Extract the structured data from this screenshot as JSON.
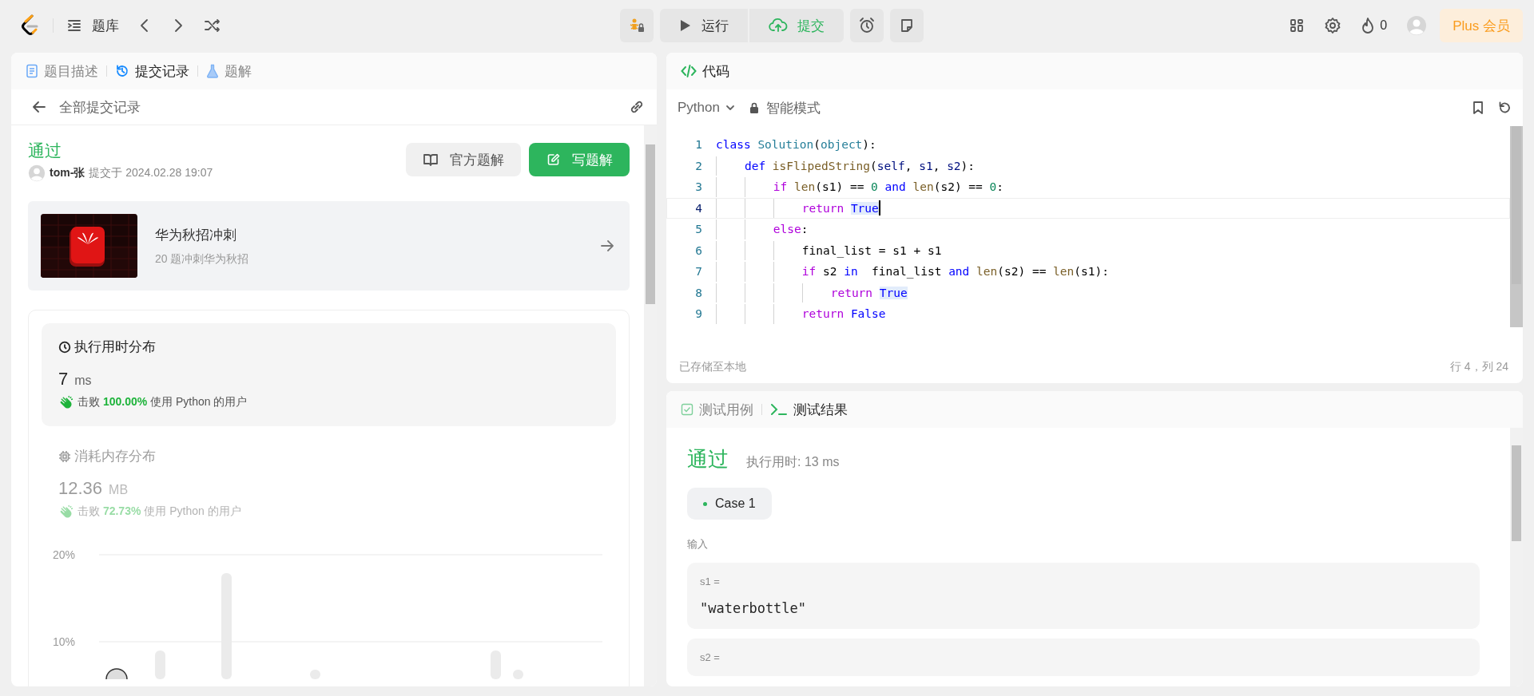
{
  "top_bar": {
    "problem_list": "题库",
    "run_button": "运行",
    "submit_button": "提交",
    "streak_count": "0",
    "plus_button": "Plus 会员"
  },
  "left_panel": {
    "tabs": [
      {
        "label": "题目描述",
        "selected": false,
        "kind": "description"
      },
      {
        "label": "提交记录",
        "selected": true,
        "kind": "history"
      },
      {
        "label": "题解",
        "selected": false,
        "kind": "solutions"
      }
    ],
    "back_link": "全部提交记录",
    "submission": {
      "status": "通过",
      "user": "tom-张",
      "submitted_at": "提交于 2024.02.28 19:07",
      "buttons": [
        {
          "label": "官方题解",
          "kind": "secondary"
        },
        {
          "label": "写题解",
          "kind": "primary"
        }
      ]
    },
    "promo": {
      "title": "华为秋招冲刺",
      "subtitle": "20 题冲刺华为秋招"
    },
    "stats": [
      {
        "kind": "runtime",
        "title": "执行用时分布",
        "value": "7",
        "unit": "ms",
        "beats_label": "击败",
        "beats": "100.00%",
        "beats_suffix": "使用 Python 的用户",
        "selected": true
      },
      {
        "kind": "memory",
        "title": "消耗内存分布",
        "value": "12.36",
        "unit": "MB",
        "beats_label": "击败",
        "beats": "72.73%",
        "beats_suffix": "使用 Python 的用户",
        "selected": false
      }
    ],
    "chart_axis_labels": [
      "20%",
      "10%"
    ]
  },
  "editor": {
    "title": "代码",
    "language": "Python",
    "mode": "智能模式",
    "lines": [
      {
        "number": "1",
        "current": false,
        "tokens": [
          {
            "kind": "kw",
            "text": "class "
          },
          {
            "kind": "cls",
            "text": "Solution"
          },
          {
            "kind": "plain",
            "text": "("
          },
          {
            "kind": "cls",
            "text": "object"
          },
          {
            "kind": "plain",
            "text": "):"
          }
        ]
      },
      {
        "number": "2",
        "current": false,
        "tokens": [
          {
            "kind": "kw",
            "text": "    def "
          },
          {
            "kind": "fn",
            "text": "isFlipedString"
          },
          {
            "kind": "plain",
            "text": "("
          },
          {
            "kind": "var",
            "text": "self"
          },
          {
            "kind": "plain",
            "text": ", "
          },
          {
            "kind": "var",
            "text": "s1"
          },
          {
            "kind": "plain",
            "text": ", "
          },
          {
            "kind": "var",
            "text": "s2"
          },
          {
            "kind": "plain",
            "text": "):"
          }
        ]
      },
      {
        "number": "3",
        "current": false,
        "tokens": [
          {
            "kind": "ctrl",
            "text": "        if "
          },
          {
            "kind": "fn",
            "text": "len"
          },
          {
            "kind": "plain",
            "text": "(s1) == "
          },
          {
            "kind": "num",
            "text": "0"
          },
          {
            "kind": "kw",
            "text": " and "
          },
          {
            "kind": "fn",
            "text": "len"
          },
          {
            "kind": "plain",
            "text": "(s2) == "
          },
          {
            "kind": "num",
            "text": "0"
          },
          {
            "kind": "plain",
            "text": ":"
          }
        ]
      },
      {
        "number": "4",
        "current": true,
        "tokens": [
          {
            "kind": "ctrl",
            "text": "            return "
          },
          {
            "kind": "bool",
            "text": "True",
            "highlighted": true
          }
        ]
      },
      {
        "number": "5",
        "current": false,
        "tokens": [
          {
            "kind": "ctrl",
            "text": "        else"
          },
          {
            "kind": "plain",
            "text": ":"
          }
        ]
      },
      {
        "number": "6",
        "current": false,
        "tokens": [
          {
            "kind": "plain",
            "text": "            final_list = s1 + s1"
          }
        ]
      },
      {
        "number": "7",
        "current": false,
        "tokens": [
          {
            "kind": "ctrl",
            "text": "            if"
          },
          {
            "kind": "plain",
            "text": " s2 "
          },
          {
            "kind": "kw",
            "text": "in"
          },
          {
            "kind": "plain",
            "text": "  final_list "
          },
          {
            "kind": "kw",
            "text": "and "
          },
          {
            "kind": "fn",
            "text": "len"
          },
          {
            "kind": "plain",
            "text": "(s2) == "
          },
          {
            "kind": "fn",
            "text": "len"
          },
          {
            "kind": "plain",
            "text": "(s1):"
          }
        ]
      },
      {
        "number": "8",
        "current": false,
        "tokens": [
          {
            "kind": "ctrl",
            "text": "                return "
          },
          {
            "kind": "bool",
            "text": "True",
            "highlighted": true
          }
        ]
      },
      {
        "number": "9",
        "current": false,
        "tokens": [
          {
            "kind": "ctrl",
            "text": "            return "
          },
          {
            "kind": "bool",
            "text": "False"
          }
        ]
      }
    ],
    "status_left": "已存储至本地",
    "cursor_position": "行 4，列 24"
  },
  "test_panel": {
    "tabs": [
      {
        "label": "测试用例",
        "selected": false,
        "kind": "cases"
      },
      {
        "label": "测试结果",
        "selected": true,
        "kind": "result"
      }
    ],
    "status": "通过",
    "runtime": "执行用时: 13 ms",
    "cases": [
      {
        "label": "Case 1",
        "selected": true,
        "passed": true
      }
    ],
    "input_label": "输入",
    "inputs": [
      {
        "name": "s1 =",
        "value": "\"waterbottle\""
      },
      {
        "name": "s2 ="
      }
    ]
  }
}
